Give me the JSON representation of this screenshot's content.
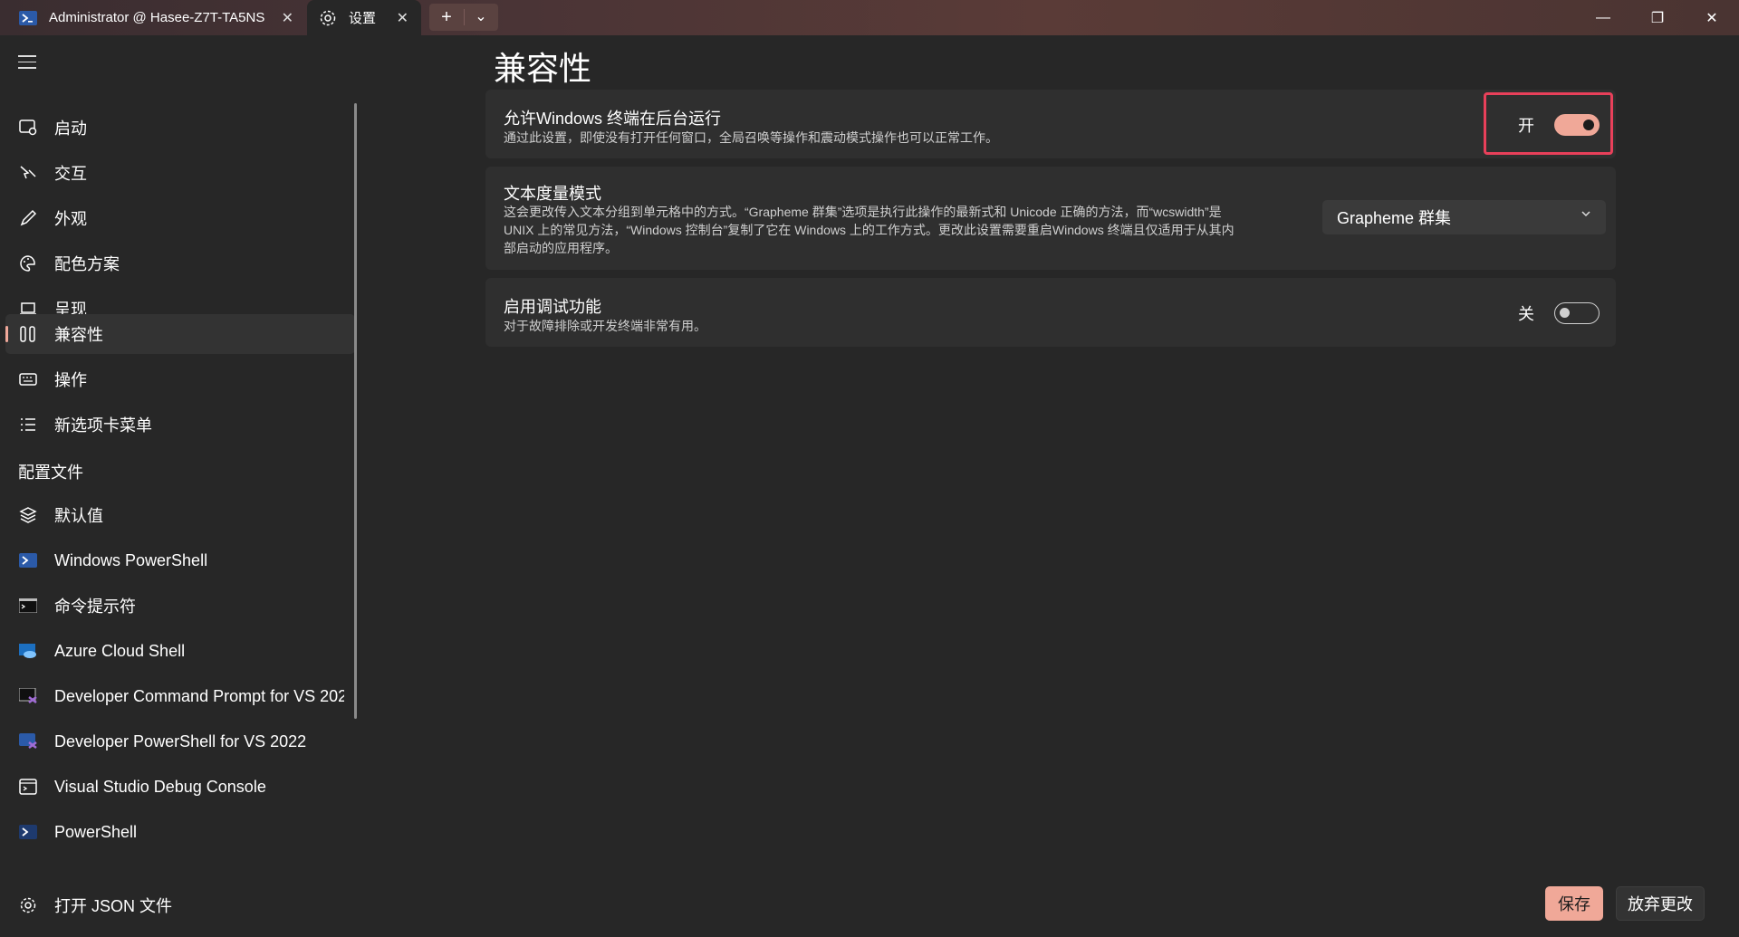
{
  "tabs": [
    {
      "title": "Administrator @ Hasee-Z7T-TA5NS",
      "icon": "powershell-icon",
      "close": "✕"
    },
    {
      "title": "设置",
      "icon": "gear-icon",
      "close": "✕"
    }
  ],
  "tab_actions": {
    "new_tab": "+",
    "dropdown": "⌄"
  },
  "window_controls": {
    "minimize": "—",
    "maximize": "❐",
    "close": "✕"
  },
  "sidebar": {
    "items": [
      {
        "label": "启动",
        "icon": "launch-icon"
      },
      {
        "label": "交互",
        "icon": "interaction-icon"
      },
      {
        "label": "外观",
        "icon": "brush-icon"
      },
      {
        "label": "配色方案",
        "icon": "palette-icon"
      },
      {
        "label": "呈现",
        "icon": "laptop-icon"
      },
      {
        "label": "兼容性",
        "icon": "compatibility-icon",
        "selected": true
      },
      {
        "label": "操作",
        "icon": "keyboard-icon"
      },
      {
        "label": "新选项卡菜单",
        "icon": "list-icon"
      }
    ],
    "section_label": "配置文件",
    "profiles": [
      {
        "label": "默认值",
        "icon": "layers-icon"
      },
      {
        "label": "Windows PowerShell",
        "icon": "powershell-icon"
      },
      {
        "label": "命令提示符",
        "icon": "cmd-icon"
      },
      {
        "label": "Azure Cloud Shell",
        "icon": "azure-icon"
      },
      {
        "label": "Developer Command Prompt for VS 2022",
        "icon": "vs-cmd-icon"
      },
      {
        "label": "Developer PowerShell for VS 2022",
        "icon": "vs-powershell-icon"
      },
      {
        "label": "Visual Studio Debug Console",
        "icon": "debug-console-icon"
      },
      {
        "label": "PowerShell",
        "icon": "powershell-icon"
      }
    ],
    "open_json": "打开 JSON 文件"
  },
  "main": {
    "title": "兼容性",
    "settings": [
      {
        "title": "允许Windows 终端在后台运行",
        "description": "通过此设置，即使没有打开任何窗口，全局召唤等操作和震动模式操作也可以正常工作。",
        "toggle_label": "开",
        "toggle_on": true
      },
      {
        "title": "文本度量模式",
        "description_lines": [
          "这会更改传入文本分组到单元格中的方式。“Grapheme 群集”选项是执行此操作的最新式和 Unicode 正确的方法，而“wcswidth”是",
          "UNIX 上的常见方法，“Windows 控制台”复制了它在 Windows 上的工作方式。更改此设置需要重启Windows 终端且仅适用于从其内",
          "部启动的应用程序。"
        ],
        "dropdown_value": "Grapheme 群集"
      },
      {
        "title": "启用调试功能",
        "description": "对于故障排除或开发终端非常有用。",
        "toggle_label": "关",
        "toggle_on": false
      }
    ]
  },
  "footer": {
    "save": "保存",
    "discard": "放弃更改"
  },
  "colors": {
    "accent": "#f0a898",
    "highlight_border": "#e8405a",
    "background": "#272727",
    "card": "#2f2f2f"
  }
}
